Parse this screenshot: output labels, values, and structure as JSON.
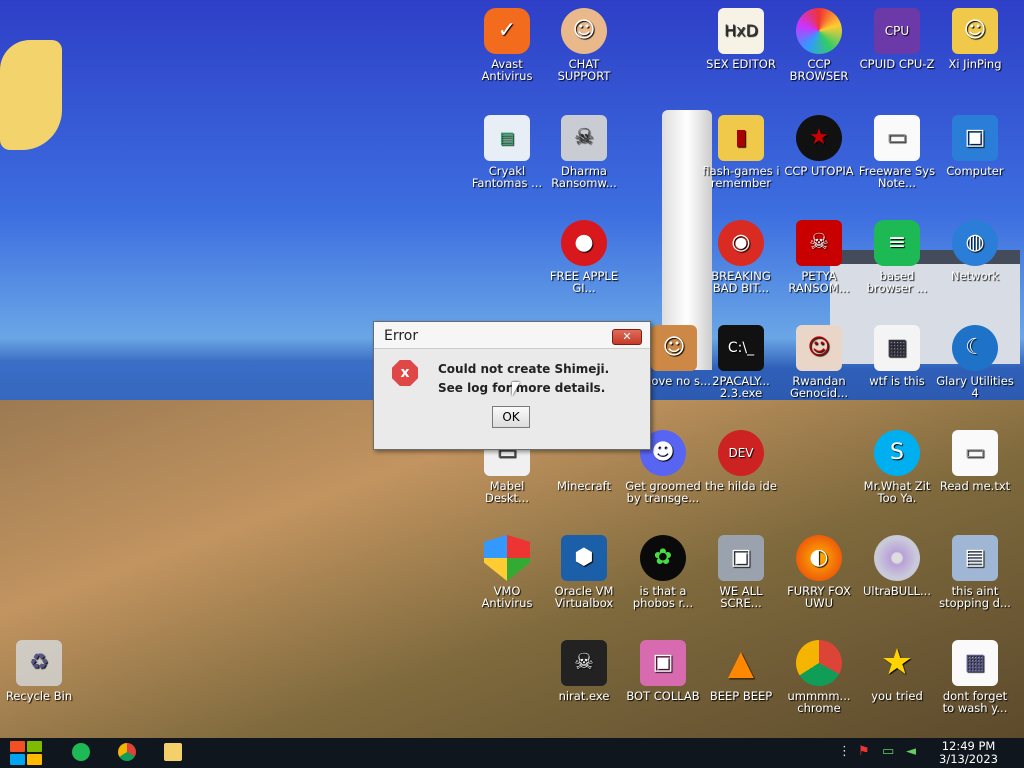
{
  "icons": {
    "avast": "Avast Antivirus",
    "chat_support": "CHAT SUPPORT",
    "hex": "SEX EDITOR",
    "ccp_browser": "CCP BROWSER",
    "cpuz": "CPUID CPU-Z",
    "xi": "Xi JinPing",
    "cryakl": "Cryakl Fantomas ...",
    "dharma": "Dharma Ransomw...",
    "flash": "flash-games i remember",
    "ccp_utopia": "CCP UTOPIA",
    "freeware": "Freeware Sys Note...",
    "computer": "Computer",
    "apple": "FREE APPLE GI...",
    "breaking": "BREAKING BAD BIT...",
    "petya": "PETYA RANSOM...",
    "based": "based browser ...",
    "network": "Network",
    "above": "above no s...",
    "twopac": "2PACALY... 2.3.exe",
    "rwandan": "Rwandan Genocid...",
    "wtf": "wtf is this",
    "glary": "Glary Utilities 4",
    "mabel": "Mabel Deskt...",
    "minecraft": "Minecraft",
    "discord": "Get groomed by transge...",
    "devcpp": "the hilda ide",
    "skype": "Mr.What Zit Too Ya.",
    "readme": "Read me.txt",
    "vmo": "VMO Antivirus",
    "oracle": "Oracle VM Virtualbox",
    "phobos": "is that a phobos r...",
    "weall": "WE ALL SCRE...",
    "furry": "FURRY FOX UWU",
    "ultra": "UltraBULL...",
    "stopping": "this aint stopping d...",
    "recycle": "Recycle Bin",
    "nirat": "nirat.exe",
    "botcollab": "BOT COLLAB",
    "beep": "BEEP BEEP",
    "chrome": "ummmm... chrome",
    "tried": "you tried",
    "wash": "dont forget to wash y..."
  },
  "dialog": {
    "title": "Error",
    "close": "✕",
    "error_glyph": "x",
    "line1": "Could not create Shimeji.",
    "line2": "See log for more details.",
    "ok": "OK"
  },
  "taskbar": {
    "time": "12:49 PM",
    "date": "3/13/2023"
  },
  "colors": {
    "taskbar": "#10161d",
    "error_red": "#e04848"
  }
}
